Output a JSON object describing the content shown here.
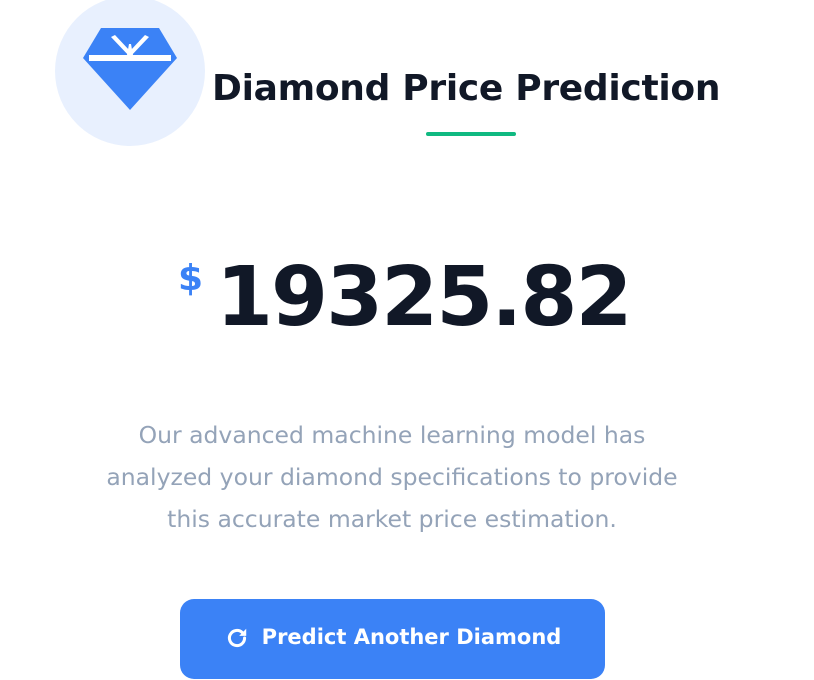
{
  "header": {
    "logo_icon": "diamond-icon",
    "title": "Diamond Price Prediction"
  },
  "result": {
    "currency_symbol": "$",
    "price": "19325.82"
  },
  "description": "Our advanced machine learning model has analyzed your diamond specifications to provide this accurate market price estimation.",
  "actions": {
    "predict_again_label": "Predict Another Diamond",
    "predict_again_icon": "redo-icon"
  },
  "colors": {
    "accent": "#3b82f6",
    "underline": "#10b981",
    "text_dark": "#111827",
    "text_muted": "#94a3b8",
    "logo_bg": "#e8f0fe"
  }
}
